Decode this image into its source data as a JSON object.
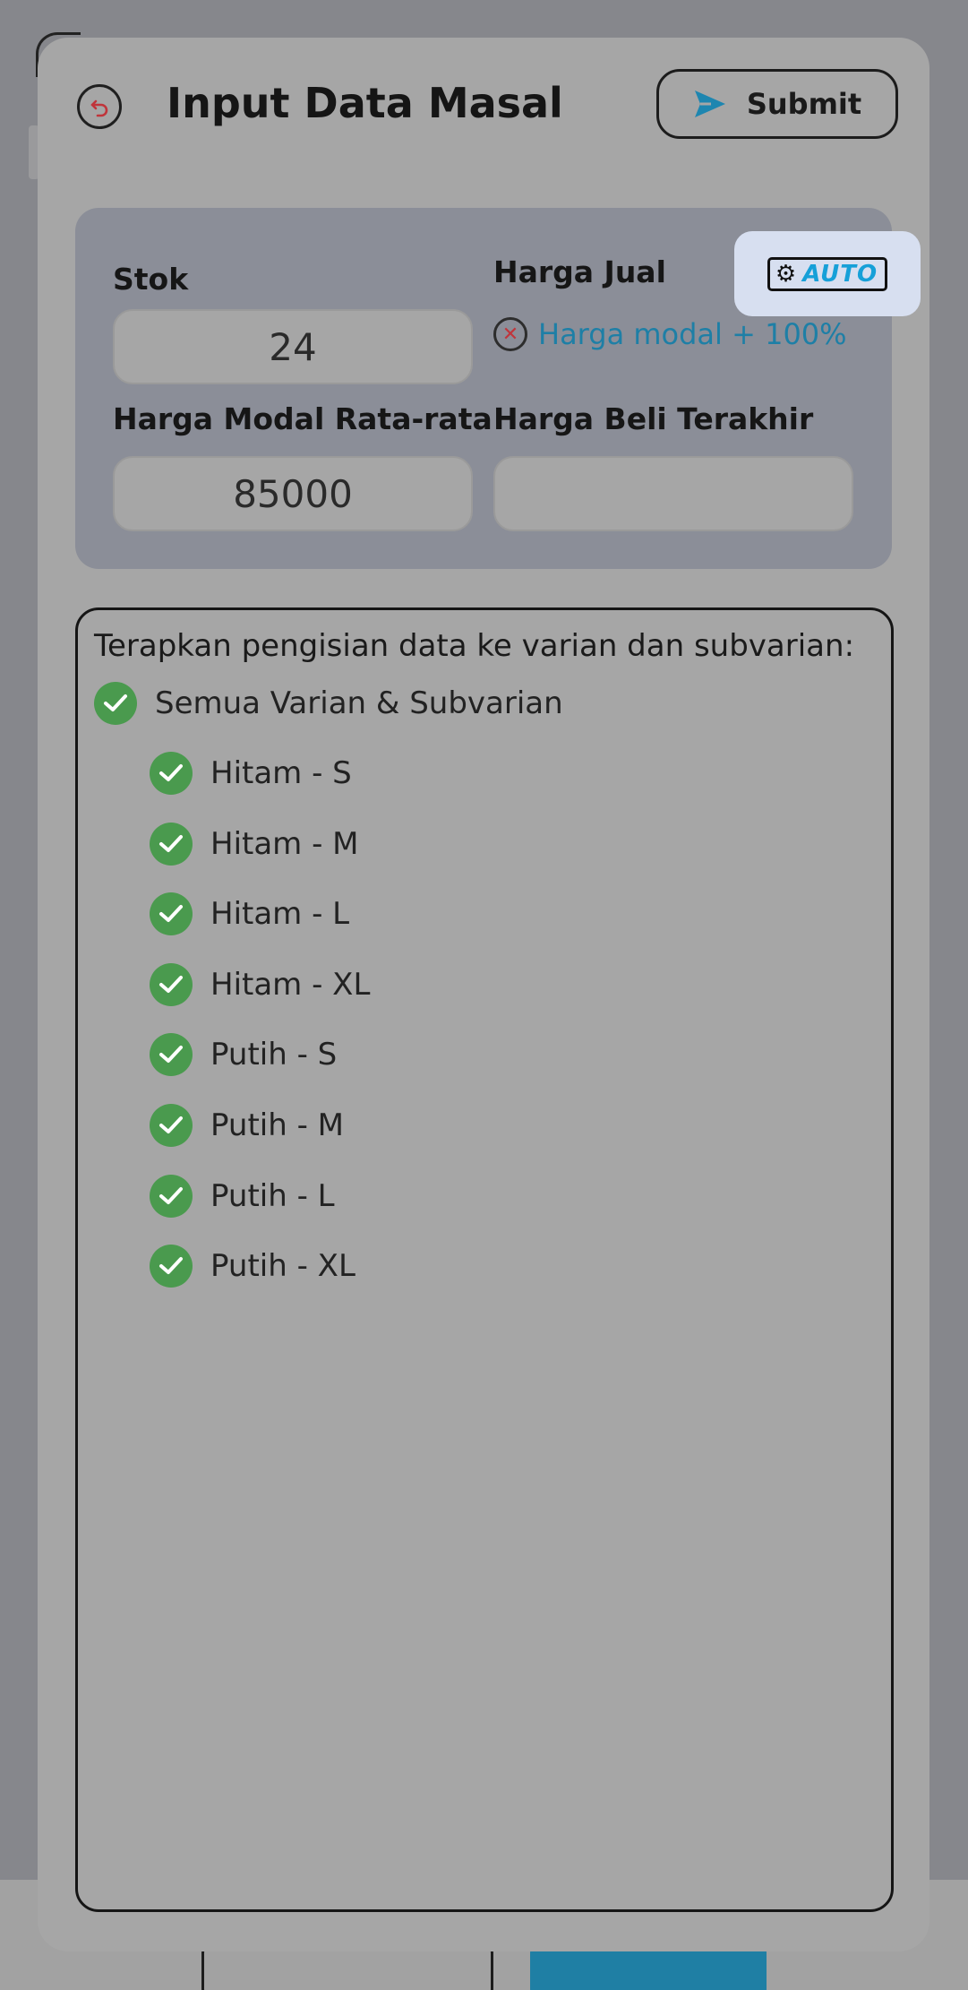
{
  "header": {
    "title": "Input Data Masal",
    "submit_label": "Submit"
  },
  "panel": {
    "stok_label": "Stok",
    "stok_value": "24",
    "harga_jual_label": "Harga Jual",
    "auto_label": "AUTO",
    "harga_jual_formula": "Harga modal + 100%",
    "modal_label": "Harga Modal Rata-rata",
    "modal_value": "85000",
    "beli_label": "Harga Beli Terakhir",
    "beli_value": ""
  },
  "variants": {
    "heading": "Terapkan pengisian data ke varian dan subvarian:",
    "all_label": "Semua Varian & Subvarian",
    "all_checked": true,
    "items": [
      {
        "label": "Hitam - S",
        "checked": true
      },
      {
        "label": "Hitam - M",
        "checked": true
      },
      {
        "label": "Hitam - L",
        "checked": true
      },
      {
        "label": "Hitam - XL",
        "checked": true
      },
      {
        "label": "Putih - S",
        "checked": true
      },
      {
        "label": "Putih - M",
        "checked": true
      },
      {
        "label": "Putih - L",
        "checked": true
      },
      {
        "label": "Putih - XL",
        "checked": true
      }
    ]
  },
  "colors": {
    "check_green": "#4a9a4e",
    "link_blue": "#1e7fa6",
    "auto_blue": "#16a0d8",
    "panel_bg": "#8b8e98"
  }
}
